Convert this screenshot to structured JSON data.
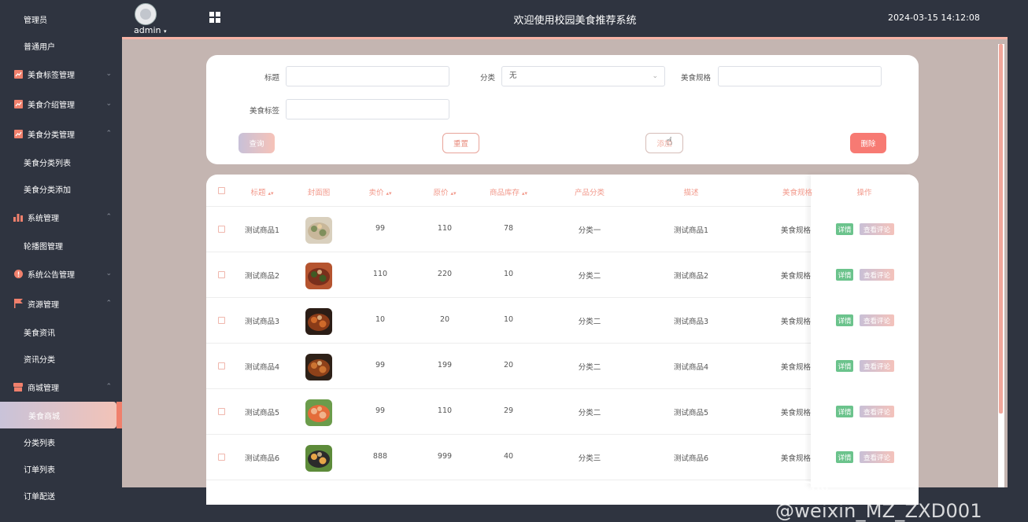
{
  "header": {
    "title": "欢迎使用校园美食推荐系统",
    "datetime": "2024-03-15 14:12:08",
    "user": "admin"
  },
  "sidebar": {
    "items": [
      {
        "label": "管理员",
        "type": "sub"
      },
      {
        "label": "普通用户",
        "type": "sub"
      },
      {
        "label": "美食标签管理",
        "type": "group",
        "icon": "chart-icon",
        "expanded": false
      },
      {
        "label": "美食介绍管理",
        "type": "group",
        "icon": "chart-icon",
        "expanded": false
      },
      {
        "label": "美食分类管理",
        "type": "group",
        "icon": "chart-icon",
        "expanded": true
      },
      {
        "label": "美食分类列表",
        "type": "sub"
      },
      {
        "label": "美食分类添加",
        "type": "sub"
      },
      {
        "label": "系统管理",
        "type": "group",
        "icon": "bar-chart-icon",
        "expanded": true
      },
      {
        "label": "轮播图管理",
        "type": "sub"
      },
      {
        "label": "系统公告管理",
        "type": "group",
        "icon": "info-icon",
        "expanded": false
      },
      {
        "label": "资源管理",
        "type": "group",
        "icon": "flag-icon",
        "expanded": true
      },
      {
        "label": "美食资讯",
        "type": "sub"
      },
      {
        "label": "资讯分类",
        "type": "sub"
      },
      {
        "label": "商城管理",
        "type": "group",
        "icon": "shop-icon",
        "expanded": true
      },
      {
        "label": "美食商城",
        "type": "sub",
        "active": true
      },
      {
        "label": "分类列表",
        "type": "sub"
      },
      {
        "label": "订单列表",
        "type": "sub"
      },
      {
        "label": "订单配送",
        "type": "sub"
      }
    ]
  },
  "filters": {
    "title_label": "标题",
    "title_value": "",
    "category_label": "分类",
    "category_value": "无",
    "spec_label": "美食规格",
    "spec_value": "",
    "tag_label": "美食标签",
    "tag_value": ""
  },
  "buttons": {
    "query": "查询",
    "reset": "重置",
    "add": "添加",
    "delete": "删除"
  },
  "table": {
    "columns": [
      "标题",
      "封面图",
      "卖价",
      "原价",
      "商品库存",
      "产品分类",
      "描述",
      "美食规格",
      "操作"
    ],
    "rows": [
      {
        "title": "测试商品1",
        "price": "99",
        "original": "110",
        "stock": "78",
        "category": "分类一",
        "desc": "测试商品1",
        "spec": "美食规格"
      },
      {
        "title": "测试商品2",
        "price": "110",
        "original": "220",
        "stock": "10",
        "category": "分类二",
        "desc": "测试商品2",
        "spec": "美食规格"
      },
      {
        "title": "测试商品3",
        "price": "10",
        "original": "20",
        "stock": "10",
        "category": "分类二",
        "desc": "测试商品3",
        "spec": "美食规格"
      },
      {
        "title": "测试商品4",
        "price": "99",
        "original": "199",
        "stock": "20",
        "category": "分类二",
        "desc": "测试商品4",
        "spec": "美食规格"
      },
      {
        "title": "测试商品5",
        "price": "99",
        "original": "110",
        "stock": "29",
        "category": "分类二",
        "desc": "测试商品5",
        "spec": "美食规格"
      },
      {
        "title": "测试商品6",
        "price": "888",
        "original": "999",
        "stock": "40",
        "category": "分类三",
        "desc": "测试商品6",
        "spec": "美食规格"
      }
    ],
    "action_detail": "详情",
    "action_comment": "查看评论"
  },
  "watermark": "CSDN @weixin_MZ_ZXD001",
  "colors": {
    "accent": "#f29a8c",
    "sidebar_bg": "#2f3440",
    "content_bg": "#c4b5b1",
    "detail_green": "#6bc38c",
    "danger": "#f77a73"
  }
}
